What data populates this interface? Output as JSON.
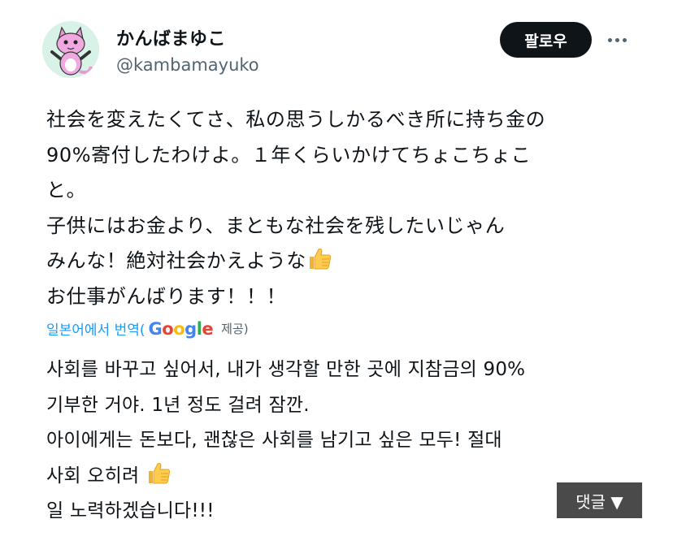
{
  "author": {
    "display_name": "かんばまゆこ",
    "handle": "@kambamayuko",
    "avatar_icon": "pink-cat-avatar-icon"
  },
  "follow_label": "팔로우",
  "more_icon": "more-dots-icon",
  "post": {
    "lines": [
      "社会を変えたくてさ、私の思うしかるべき所に持ち金の",
      "90%寄付したわけよ。１年くらいかけてちょこちょこ",
      "と。",
      "子供にはお金より、まともな社会を残したいじゃん",
      "みんな！絶対社会かえような",
      "お仕事がんばります！！！"
    ],
    "emoji": "thumbs-up-icon"
  },
  "translation": {
    "label": "일본어에서 번역(",
    "provider": "Google",
    "provided": "제공)",
    "lines": [
      "사회를 바꾸고 싶어서, 내가 생각할 만한 곳에 지참금의 90%",
      "기부한 거야. 1년 정도 걸려 잠깐.",
      "아이에게는 돈보다, 괜찮은 사회를 남기고 싶은 모두! 절대",
      "사회 오히려",
      "일 노력하겠습니다!!!"
    ]
  },
  "comments_label": "댓글 ▼",
  "colors": {
    "text": "#0f1419",
    "secondary": "#536471",
    "link": "#1d9bf0",
    "button_dark": "#0f1419",
    "overlay": "#4a4a4a"
  }
}
